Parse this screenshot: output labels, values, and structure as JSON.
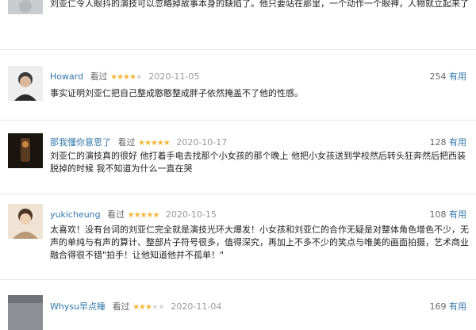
{
  "top_fragment": {
    "text": "刘亚仁令人眼抖的演技可以忽略掉故事本身的缺陷了。他只要站在那里，一个动作一个眼神，人物就立起来了"
  },
  "reviews": [
    {
      "user": "Howard",
      "action": "看过",
      "stars": 4,
      "date": "2020-11-05",
      "votes": "254",
      "useful_label": "有用",
      "content": "事实证明刘亚仁把自己整成憨憨整成胖子依然掩盖不了他的性感。"
    },
    {
      "user": "那我懂你意思了",
      "action": "看过",
      "stars": 5,
      "date": "2020-10-17",
      "votes": "128",
      "useful_label": "有用",
      "content": "刘亚仁的演技真的很好 他打着手电去找那个小女孩的那个晚上 他把小女孩送到学校然后转头狂奔然后把西装脱掉的时候 我不知道为什么一直在哭"
    },
    {
      "user": "yukicheung",
      "action": "看过",
      "stars": 5,
      "date": "2020-10-15",
      "votes": "108",
      "useful_label": "有用",
      "content": "太喜欢！没有台词的刘亚仁完全就是演技光环大爆发！小女孩和刘亚仁的合作无疑是对整体角色增色不少，无声的单纯与有声的算计、整部片子符号很多，值得深究，再加上不多不少的笑点与唯美的画面拍摄，艺术商业融合得很不错\"拍手！让他知道他并不孤单！\""
    },
    {
      "user": "Whysu早点睡",
      "action": "看过",
      "stars": 3,
      "date": "2020-11-04",
      "votes": "169",
      "useful_label": "有用",
      "content": ""
    }
  ],
  "icons": {
    "avatar": "user-avatar-photo",
    "star": "rating-star"
  },
  "colors": {
    "link": "#3377aa",
    "star": "#f4b73a",
    "muted": "#999999"
  }
}
